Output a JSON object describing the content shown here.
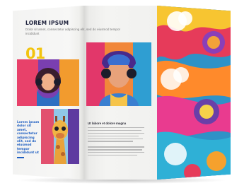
{
  "brochure": {
    "heading": "LOREM IPSUM",
    "subheading": "Dolor sit amet, consectetur adipiscing elit, sed do eiusmod tempor incididunt",
    "number": "01",
    "blue_text": "Lorem ipsum dolor sit amet, consectetur adipiscing elit, sed do eiusmod tempor incididunt ut",
    "mid_title": "Ut labore et dolore magna",
    "images": [
      "woman-with-headphones",
      "man-with-headphones",
      "giraffe",
      "swirl-art-cover"
    ]
  },
  "colors": {
    "accent_yellow": "#f2c40f",
    "accent_blue": "#1f5fc2",
    "heading": "#1b1f3a"
  }
}
